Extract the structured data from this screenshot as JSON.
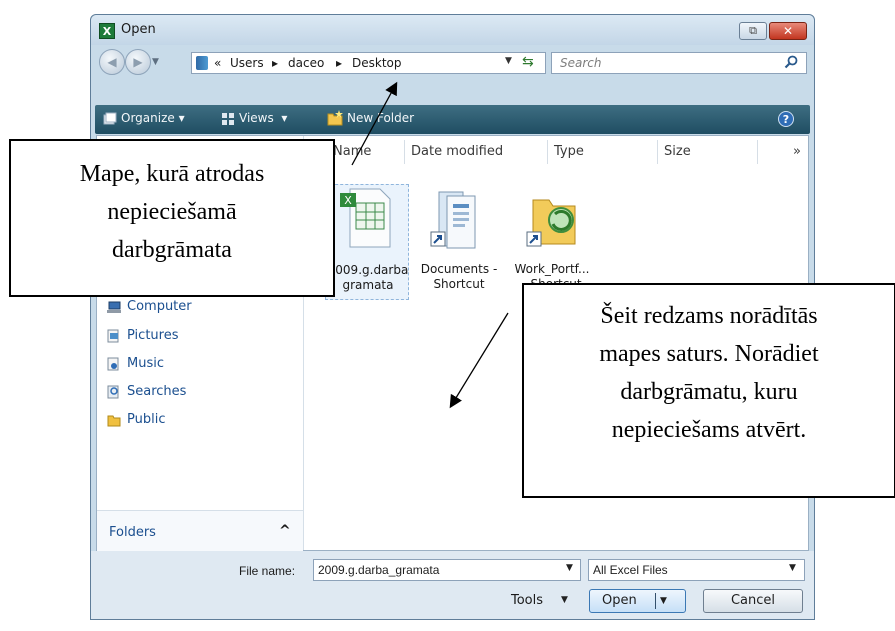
{
  "window": {
    "title": "Open",
    "restore_glyph": "⧉",
    "close_glyph": "✕"
  },
  "nav": {
    "back_glyph": "◀",
    "forward_glyph": "▶",
    "breadcrumb": [
      "«",
      "Users",
      "▸",
      "daceo",
      "▸",
      "Desktop"
    ],
    "search_placeholder": "Search"
  },
  "toolbar": {
    "organize": "Organize",
    "views": "Views",
    "new_folder": "New Folder",
    "help": "?"
  },
  "columns": [
    "Name",
    "Date modified",
    "Type",
    "Size",
    "»"
  ],
  "sidebar": {
    "items": [
      {
        "label": "Computer",
        "icon": "computer-icon"
      },
      {
        "label": "Pictures",
        "icon": "pictures-icon"
      },
      {
        "label": "Music",
        "icon": "music-icon"
      },
      {
        "label": "Searches",
        "icon": "searches-icon"
      },
      {
        "label": "Public",
        "icon": "public-folder-icon"
      }
    ],
    "folders_label": "Folders",
    "folders_chevron": "^"
  },
  "files": [
    {
      "line1": "2009.g.darba",
      "line2": "gramata",
      "icon": "excel-workbook-icon",
      "selected": true
    },
    {
      "line1": "Documents -",
      "line2": "Shortcut",
      "icon": "documents-shortcut-icon",
      "selected": false
    },
    {
      "line1": "Work_Portf...",
      "line2": "- Shortcut",
      "icon": "folder-shortcut-icon",
      "selected": false
    }
  ],
  "bottom": {
    "file_name_label": "File name:",
    "file_name_value": "2009.g.darba_gramata",
    "file_type_value": "All Excel Files",
    "tools_label": "Tools",
    "open_label": "Open",
    "cancel_label": "Cancel"
  },
  "callouts": {
    "folder_note": [
      "Mape, kurā atrodas",
      "nepieciešamā",
      "darbgrāmata"
    ],
    "content_note": [
      "Šeit redzams norādītās",
      "mapes saturs. Norādiet",
      "darbgrāmatu, kuru",
      "nepieciešams atvērt."
    ]
  }
}
